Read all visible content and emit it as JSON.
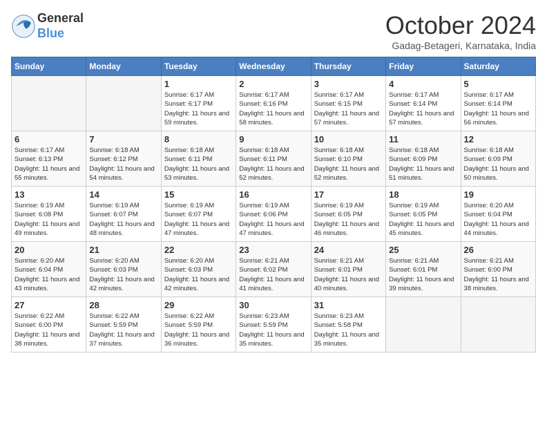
{
  "header": {
    "logo_general": "General",
    "logo_blue": "Blue",
    "month_title": "October 2024",
    "location": "Gadag-Betageri, Karnataka, India"
  },
  "weekdays": [
    "Sunday",
    "Monday",
    "Tuesday",
    "Wednesday",
    "Thursday",
    "Friday",
    "Saturday"
  ],
  "weeks": [
    [
      {
        "day": "",
        "info": ""
      },
      {
        "day": "",
        "info": ""
      },
      {
        "day": "1",
        "info": "Sunrise: 6:17 AM\nSunset: 6:17 PM\nDaylight: 11 hours and 59 minutes."
      },
      {
        "day": "2",
        "info": "Sunrise: 6:17 AM\nSunset: 6:16 PM\nDaylight: 11 hours and 58 minutes."
      },
      {
        "day": "3",
        "info": "Sunrise: 6:17 AM\nSunset: 6:15 PM\nDaylight: 11 hours and 57 minutes."
      },
      {
        "day": "4",
        "info": "Sunrise: 6:17 AM\nSunset: 6:14 PM\nDaylight: 11 hours and 57 minutes."
      },
      {
        "day": "5",
        "info": "Sunrise: 6:17 AM\nSunset: 6:14 PM\nDaylight: 11 hours and 56 minutes."
      }
    ],
    [
      {
        "day": "6",
        "info": "Sunrise: 6:17 AM\nSunset: 6:13 PM\nDaylight: 11 hours and 55 minutes."
      },
      {
        "day": "7",
        "info": "Sunrise: 6:18 AM\nSunset: 6:12 PM\nDaylight: 11 hours and 54 minutes."
      },
      {
        "day": "8",
        "info": "Sunrise: 6:18 AM\nSunset: 6:11 PM\nDaylight: 11 hours and 53 minutes."
      },
      {
        "day": "9",
        "info": "Sunrise: 6:18 AM\nSunset: 6:11 PM\nDaylight: 11 hours and 52 minutes."
      },
      {
        "day": "10",
        "info": "Sunrise: 6:18 AM\nSunset: 6:10 PM\nDaylight: 11 hours and 52 minutes."
      },
      {
        "day": "11",
        "info": "Sunrise: 6:18 AM\nSunset: 6:09 PM\nDaylight: 11 hours and 51 minutes."
      },
      {
        "day": "12",
        "info": "Sunrise: 6:18 AM\nSunset: 6:09 PM\nDaylight: 11 hours and 50 minutes."
      }
    ],
    [
      {
        "day": "13",
        "info": "Sunrise: 6:19 AM\nSunset: 6:08 PM\nDaylight: 11 hours and 49 minutes."
      },
      {
        "day": "14",
        "info": "Sunrise: 6:19 AM\nSunset: 6:07 PM\nDaylight: 11 hours and 48 minutes."
      },
      {
        "day": "15",
        "info": "Sunrise: 6:19 AM\nSunset: 6:07 PM\nDaylight: 11 hours and 47 minutes."
      },
      {
        "day": "16",
        "info": "Sunrise: 6:19 AM\nSunset: 6:06 PM\nDaylight: 11 hours and 47 minutes."
      },
      {
        "day": "17",
        "info": "Sunrise: 6:19 AM\nSunset: 6:05 PM\nDaylight: 11 hours and 46 minutes."
      },
      {
        "day": "18",
        "info": "Sunrise: 6:19 AM\nSunset: 6:05 PM\nDaylight: 11 hours and 45 minutes."
      },
      {
        "day": "19",
        "info": "Sunrise: 6:20 AM\nSunset: 6:04 PM\nDaylight: 11 hours and 44 minutes."
      }
    ],
    [
      {
        "day": "20",
        "info": "Sunrise: 6:20 AM\nSunset: 6:04 PM\nDaylight: 11 hours and 43 minutes."
      },
      {
        "day": "21",
        "info": "Sunrise: 6:20 AM\nSunset: 6:03 PM\nDaylight: 11 hours and 42 minutes."
      },
      {
        "day": "22",
        "info": "Sunrise: 6:20 AM\nSunset: 6:03 PM\nDaylight: 11 hours and 42 minutes."
      },
      {
        "day": "23",
        "info": "Sunrise: 6:21 AM\nSunset: 6:02 PM\nDaylight: 11 hours and 41 minutes."
      },
      {
        "day": "24",
        "info": "Sunrise: 6:21 AM\nSunset: 6:01 PM\nDaylight: 11 hours and 40 minutes."
      },
      {
        "day": "25",
        "info": "Sunrise: 6:21 AM\nSunset: 6:01 PM\nDaylight: 11 hours and 39 minutes."
      },
      {
        "day": "26",
        "info": "Sunrise: 6:21 AM\nSunset: 6:00 PM\nDaylight: 11 hours and 38 minutes."
      }
    ],
    [
      {
        "day": "27",
        "info": "Sunrise: 6:22 AM\nSunset: 6:00 PM\nDaylight: 11 hours and 38 minutes."
      },
      {
        "day": "28",
        "info": "Sunrise: 6:22 AM\nSunset: 5:59 PM\nDaylight: 11 hours and 37 minutes."
      },
      {
        "day": "29",
        "info": "Sunrise: 6:22 AM\nSunset: 5:59 PM\nDaylight: 11 hours and 36 minutes."
      },
      {
        "day": "30",
        "info": "Sunrise: 6:23 AM\nSunset: 5:59 PM\nDaylight: 11 hours and 35 minutes."
      },
      {
        "day": "31",
        "info": "Sunrise: 6:23 AM\nSunset: 5:58 PM\nDaylight: 11 hours and 35 minutes."
      },
      {
        "day": "",
        "info": ""
      },
      {
        "day": "",
        "info": ""
      }
    ]
  ]
}
